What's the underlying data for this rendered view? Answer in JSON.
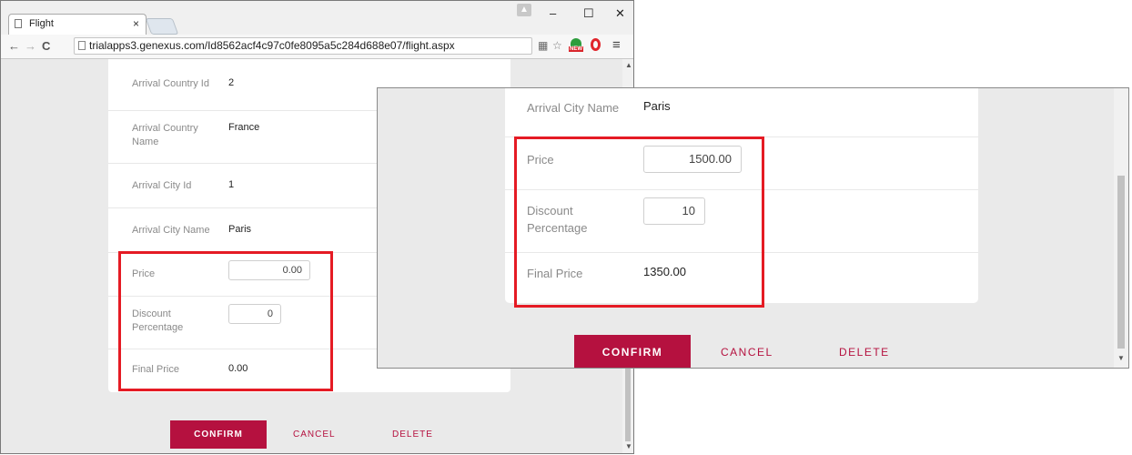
{
  "browser": {
    "tab_title": "Flight",
    "tab_close": "×",
    "url": "trialapps3.genexus.com/Id8562acf4c97c0fe8095a5c284d688e07/flight.aspx",
    "back": "←",
    "forward": "→",
    "reload": "C",
    "minimize": "–",
    "maximize": "☐",
    "close": "✕",
    "menu": "≡",
    "star": "☆",
    "new_badge": "NEW"
  },
  "form_before": {
    "rows": [
      {
        "label": "Arrival Country Id",
        "value": "2"
      },
      {
        "label": "Arrival Country Name",
        "value": "France"
      },
      {
        "label": "Arrival City Id",
        "value": "1"
      },
      {
        "label": "Arrival City Name",
        "value": "Paris"
      }
    ],
    "price_label": "Price",
    "price_value": "0.00",
    "discount_label": "Discount Percentage",
    "discount_value": "0",
    "final_label": "Final Price",
    "final_value": "0.00",
    "confirm": "CONFIRM",
    "cancel": "CANCEL",
    "delete": "DELETE"
  },
  "form_after": {
    "city_label": "Arrival City Name",
    "city_value": "Paris",
    "price_label": "Price",
    "price_value": "1500.00",
    "discount_label": "Discount Percentage",
    "discount_value": "10",
    "final_label": "Final Price",
    "final_value": "1350.00",
    "confirm": "CONFIRM",
    "cancel": "CANCEL",
    "delete": "DELETE"
  },
  "colors": {
    "accent": "#b5113f",
    "highlight": "#e51b24"
  }
}
